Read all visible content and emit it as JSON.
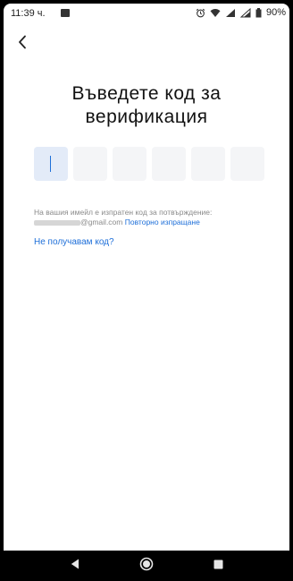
{
  "status_bar": {
    "time": "11:39 ч.",
    "battery": "90%",
    "icons": [
      "image-icon",
      "alarm-icon",
      "wifi-icon",
      "signal-icon",
      "battery-icon"
    ]
  },
  "header": {
    "back_icon": "chevron-left-icon"
  },
  "main": {
    "title": "Въведете код за\nверификация",
    "code_length": 6,
    "info_text": "На вашия имейл е изпратен код за потвърждение:",
    "email_suffix": "@gmail.com",
    "resend_link": "Повторно изпращане",
    "no_code_link": "Не получавам код?"
  },
  "nav_bar": {
    "icons": [
      "back-triangle-icon",
      "home-circle-icon",
      "recents-square-icon"
    ]
  },
  "colors": {
    "accent": "#1e6fd9",
    "box_bg": "#f4f5f7",
    "active_box_bg": "#e3ebf8"
  }
}
